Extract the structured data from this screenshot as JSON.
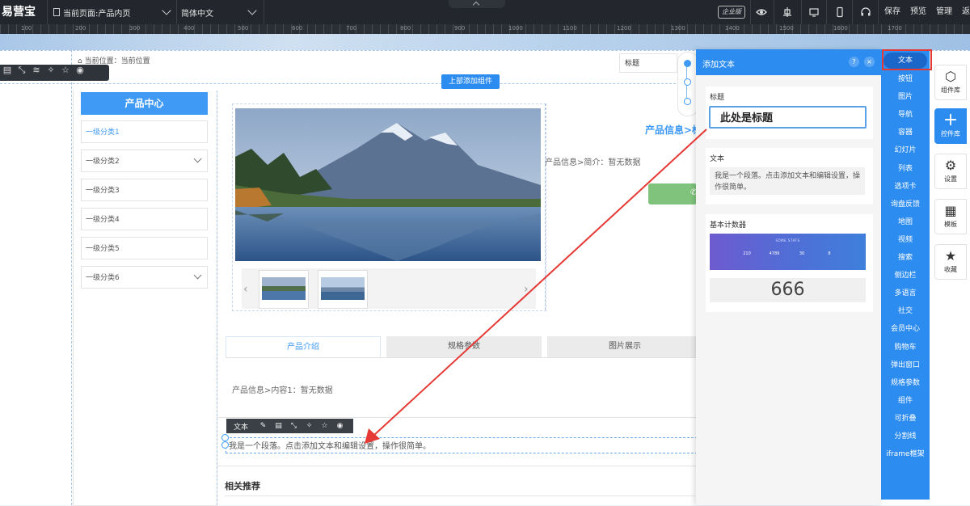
{
  "topbar": {
    "logo": "易营宝",
    "current_page": "当前页面:产品内页",
    "language": "简体中文",
    "edition": "企业版",
    "buttons": {
      "save": "保存",
      "preview": "预览",
      "manage": "管理",
      "back": "返"
    }
  },
  "ruler": {
    "labels": [
      "100",
      "200",
      "300",
      "400",
      "500",
      "600",
      "700",
      "800",
      "900",
      "1000",
      "1100",
      "1200",
      "1300",
      "1400",
      "1500",
      "1600",
      "1700"
    ]
  },
  "canvas": {
    "breadcrumb": "当前位置：当前位置",
    "add_top_button": "上部添加组件",
    "category": {
      "header": "产品中心",
      "items": [
        {
          "label": "一级分类1",
          "expandable": false
        },
        {
          "label": "一级分类2",
          "expandable": true
        },
        {
          "label": "一级分类3",
          "expandable": false
        },
        {
          "label": "一级分类4",
          "expandable": false
        },
        {
          "label": "一级分类5",
          "expandable": false
        },
        {
          "label": "一级分类6",
          "expandable": true
        }
      ]
    },
    "product": {
      "title": "产品信息>标",
      "brief": "产品信息>简介：暂无数据"
    },
    "tabs": [
      "产品介绍",
      "规格参数",
      "图片展示"
    ],
    "tab_content": "产品信息>内容1：暂无数据",
    "text_toolbar_label": "文本",
    "text_component": "我是一个段落。点击添加文本和编辑设置，操作很简单。",
    "related": "相关推荐"
  },
  "title_popover": {
    "label": "标题"
  },
  "panel": {
    "title": "添加文本",
    "help": "?",
    "close": "×",
    "cards": {
      "heading": {
        "label": "标题",
        "sample": "此处是标题"
      },
      "text": {
        "label": "文本",
        "sample": "我是一个段落。点击添加文本和编辑设置，操作很简单。"
      },
      "counter": {
        "label": "基本计数器",
        "banner_title": "SOME STATS",
        "numbers": [
          "210",
          "4789",
          "30",
          "8"
        ],
        "big_value": "666"
      }
    }
  },
  "category_column": {
    "active": "文本",
    "items": [
      "按钮",
      "图片",
      "导航",
      "容器",
      "幻灯片",
      "列表",
      "选项卡",
      "询盘反馈",
      "地图",
      "视频",
      "搜索",
      "侧边栏",
      "多语言",
      "社交",
      "会员中心",
      "购物车",
      "弹出窗口",
      "规格参数",
      "组件",
      "可折叠",
      "分割线",
      "iframe框架"
    ]
  },
  "right_rail": [
    {
      "label": "组件库",
      "icon": "cube-icon"
    },
    {
      "label": "控件库",
      "icon": "plus-icon"
    },
    {
      "label": "设置",
      "icon": "gears-icon"
    },
    {
      "label": "模板",
      "icon": "grid-icon"
    },
    {
      "label": "收藏",
      "icon": "star-icon"
    }
  ],
  "colors": {
    "accent": "#2d8cf0",
    "highlight": "#e53935",
    "topbar": "#23272d"
  }
}
